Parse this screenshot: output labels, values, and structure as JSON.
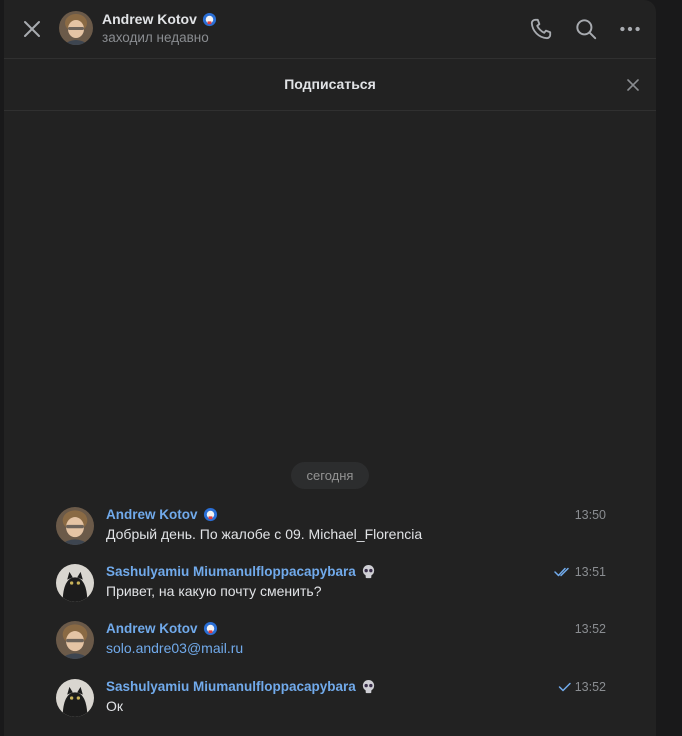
{
  "header": {
    "name": "Andrew Kotov",
    "status": "заходил недавно",
    "badge_icon": "globe-badge-icon",
    "actions": [
      "phone-icon",
      "search-icon",
      "more-icon"
    ]
  },
  "subscribe_bar": {
    "label": "Подписаться"
  },
  "date_divider": "сегодня",
  "messages": [
    {
      "author": "Andrew Kotov",
      "badge_icon": "globe-badge-icon",
      "text": "Добрый день. По жалобе с 09. Michael_Florencia",
      "time": "13:50",
      "read_status": "none"
    },
    {
      "author": "Sashulyamiu Miumanulfloppacapybara",
      "badge_icon": "skull-badge-icon",
      "text": "Привет, на какую почту сменить?",
      "time": "13:51",
      "read_status": "double-check"
    },
    {
      "author": "Andrew Kotov",
      "badge_icon": "globe-badge-icon",
      "text": "solo.andre03@mail.ru",
      "time": "13:52",
      "read_status": "none"
    },
    {
      "author": "Sashulyamiu Miumanulfloppacapybara",
      "badge_icon": "skull-badge-icon",
      "text": "Ок",
      "time": "13:52",
      "read_status": "single-check"
    }
  ],
  "colors": {
    "background": "#222222",
    "link": "#71aaeb",
    "muted": "#8a8d91",
    "text": "#e1e3e6"
  }
}
